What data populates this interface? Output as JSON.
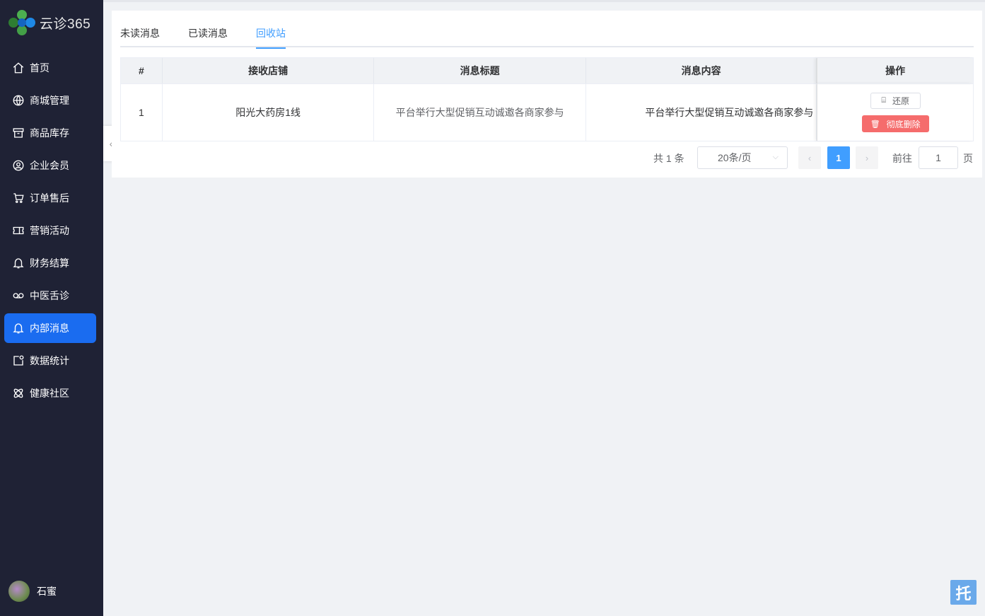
{
  "app": {
    "logo_text": "云诊365"
  },
  "sidebar": {
    "items": [
      {
        "label": "首页",
        "icon": "home-icon"
      },
      {
        "label": "商城管理",
        "icon": "globe-icon"
      },
      {
        "label": "商品库存",
        "icon": "archive-icon"
      },
      {
        "label": "企业会员",
        "icon": "user-circle-icon"
      },
      {
        "label": "订单售后",
        "icon": "cart-icon"
      },
      {
        "label": "营销活动",
        "icon": "ticket-icon"
      },
      {
        "label": "财务结算",
        "icon": "bell-icon"
      },
      {
        "label": "中医舌诊",
        "icon": "voicemail-icon"
      },
      {
        "label": "内部消息",
        "icon": "bell-icon",
        "active": true
      },
      {
        "label": "数据统计",
        "icon": "notification-icon"
      },
      {
        "label": "健康社区",
        "icon": "atom-icon"
      }
    ],
    "user_name": "石蜜"
  },
  "tabs": [
    {
      "label": "未读消息"
    },
    {
      "label": "已读消息"
    },
    {
      "label": "回收站",
      "active": true
    }
  ],
  "table": {
    "headers": [
      "#",
      "接收店铺",
      "消息标题",
      "消息内容",
      "操作"
    ],
    "rows": [
      {
        "index": "1",
        "store": "阳光大药房1线",
        "title": "平台举行大型促销互动诚邀各商家参与",
        "content": "平台举行大型促销互动诚邀各商家参与"
      }
    ],
    "restore_label": "还原",
    "delete_label": "彻底删除"
  },
  "pagination": {
    "total_text": "共 1 条",
    "page_size": "20条/页",
    "current_page": "1",
    "goto_label": "前往",
    "goto_value": "1",
    "page_suffix": "页"
  },
  "float_button": "托",
  "colors": {
    "sidebar_bg": "#1f2235",
    "active_nav": "#1a6cf0",
    "primary": "#409eff",
    "danger": "#f56c6c"
  }
}
